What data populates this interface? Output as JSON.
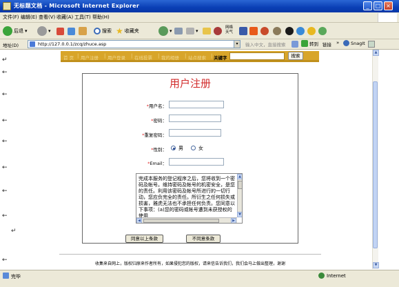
{
  "window": {
    "title": "无标题文档 - Microsoft Internet Explorer"
  },
  "menu": [
    "文件(F)",
    "编辑(E)",
    "查看(V)",
    "收藏(A)",
    "工具(T)",
    "帮助(H)"
  ],
  "toolbar": {
    "back": "后退",
    "search": "搜索",
    "favorites": "收藏夹",
    "weather_a": "网络",
    "weather_b": "天气"
  },
  "address": {
    "label": "地址(D)",
    "url": "http://127.0.0.1/zcq/zhuce.asp",
    "search_hint": "输入中文，直接搜索",
    "go": "转到",
    "links": "链接",
    "snagit": "SnagIt"
  },
  "nav": {
    "links": [
      "首 页",
      "用户注册",
      "用户登录",
      "在线投票",
      "我的相册",
      "站点搜索"
    ],
    "keyword_label": "关键字",
    "search_button": "搜索"
  },
  "form": {
    "title": "用户注册",
    "fields": {
      "username": "用户名：",
      "password": "密码：",
      "confirm": "重复密码：",
      "gender": "性别：",
      "email": "Email："
    },
    "required_mark": "*",
    "gender_options": {
      "male": "男",
      "female": "女"
    },
    "terms": "完成本服务的登记程序之后，您将收到一个密码及帐号。维持密码及帐号的机密安全，是您的责任。利用该密码及帐号所进行的一切行动，您应负完全的责任。所衍生之任何损失或损害，雅虎无法也不承担任何负责。您同意以下事项：(a)您的密码或帐号遭到未获授权的使用",
    "agree_button": "同意以上条款",
    "disagree_button": "不同意条款"
  },
  "footer": {
    "text": "收集来自网上，版权归原来作者所有，如果侵犯您的版权，请来信告诉我们，我们会马上做出整理，谢谢"
  },
  "status": {
    "left": "完毕",
    "zone": "Internet"
  },
  "colors": {
    "accent_red": "#d22a2a",
    "nav_gold": "#d8a52a",
    "xp_blue": "#0a3fb5"
  }
}
